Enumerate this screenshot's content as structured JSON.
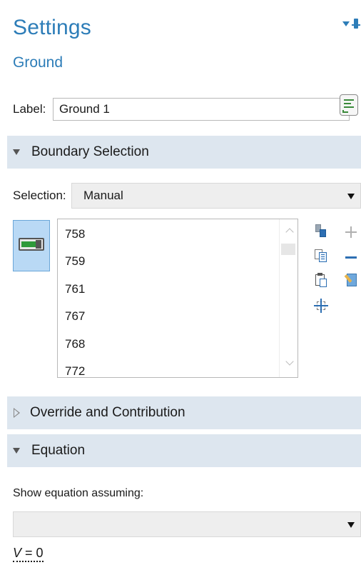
{
  "panel": {
    "title": "Settings",
    "subtitle": "Ground"
  },
  "label_row": {
    "label": "Label:",
    "value": "Ground 1"
  },
  "sections": {
    "boundary_selection": "Boundary Selection",
    "override": "Override and Contribution",
    "equation": "Equation"
  },
  "selection": {
    "label": "Selection:",
    "value": "Manual",
    "items": [
      "758",
      "759",
      "761",
      "767",
      "768",
      "772"
    ]
  },
  "equation": {
    "assume_label": "Show equation assuming:",
    "assume_value": "",
    "formula_var": "V",
    "formula_rest": " = 0"
  },
  "colors": {
    "accent": "#2d7db8",
    "section_bg": "#dde6ef",
    "toggle_active": "#b9d9f5"
  },
  "icons": [
    "pin-icon",
    "notes-icon",
    "active-toggle-icon",
    "paste-selection-icon",
    "add-icon",
    "copy-selection-icon",
    "remove-icon",
    "paste-icon",
    "clear-selection-icon",
    "zoom-to-selection-icon"
  ]
}
